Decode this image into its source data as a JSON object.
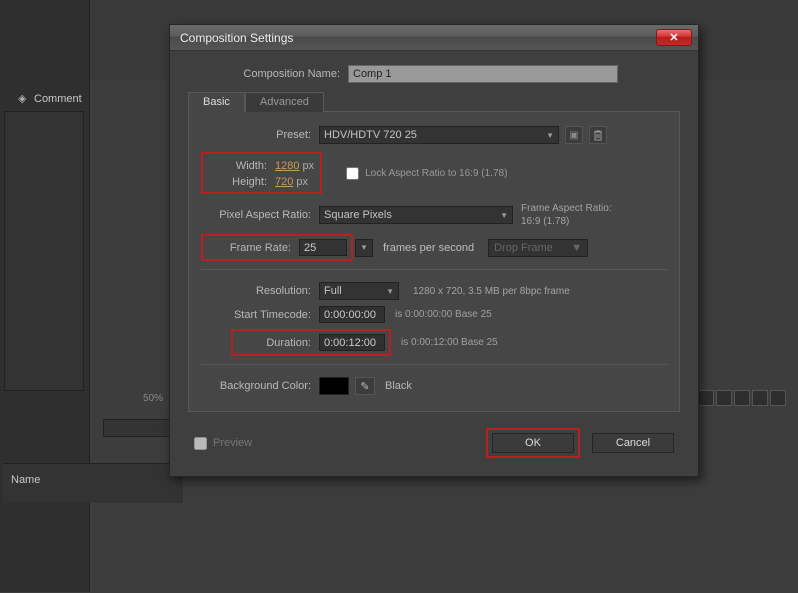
{
  "app": {
    "comment_tab": "Comment",
    "zoom": "50%",
    "name_panel": "Name"
  },
  "dialog": {
    "title": "Composition Settings",
    "name_label": "Composition Name:",
    "name_value": "Comp 1",
    "tabs": {
      "basic": "Basic",
      "advanced": "Advanced"
    },
    "preset": {
      "label": "Preset:",
      "value": "HDV/HDTV 720 25"
    },
    "width": {
      "label": "Width:",
      "value": "1280",
      "unit": "px"
    },
    "height": {
      "label": "Height:",
      "value": "720",
      "unit": "px"
    },
    "lock_aspect": "Lock Aspect Ratio to 16:9 (1.78)",
    "par": {
      "label": "Pixel Aspect Ratio:",
      "value": "Square Pixels"
    },
    "far": {
      "label": "Frame Aspect Ratio:",
      "value": "16:9 (1.78)"
    },
    "fps": {
      "label": "Frame Rate:",
      "value": "25",
      "suffix": "frames per second",
      "drop": "Drop Frame"
    },
    "res": {
      "label": "Resolution:",
      "value": "Full",
      "desc": "1280 x 720, 3.5 MB per 8bpc frame"
    },
    "start": {
      "label": "Start Timecode:",
      "value": "0:00:00:00",
      "desc": "is 0:00:00:00  Base 25"
    },
    "dur": {
      "label": "Duration:",
      "value": "0:00:12:00",
      "desc": "is 0:00:12:00  Base 25"
    },
    "bg": {
      "label": "Background Color:",
      "name": "Black"
    },
    "preview": "Preview",
    "ok": "OK",
    "cancel": "Cancel"
  }
}
